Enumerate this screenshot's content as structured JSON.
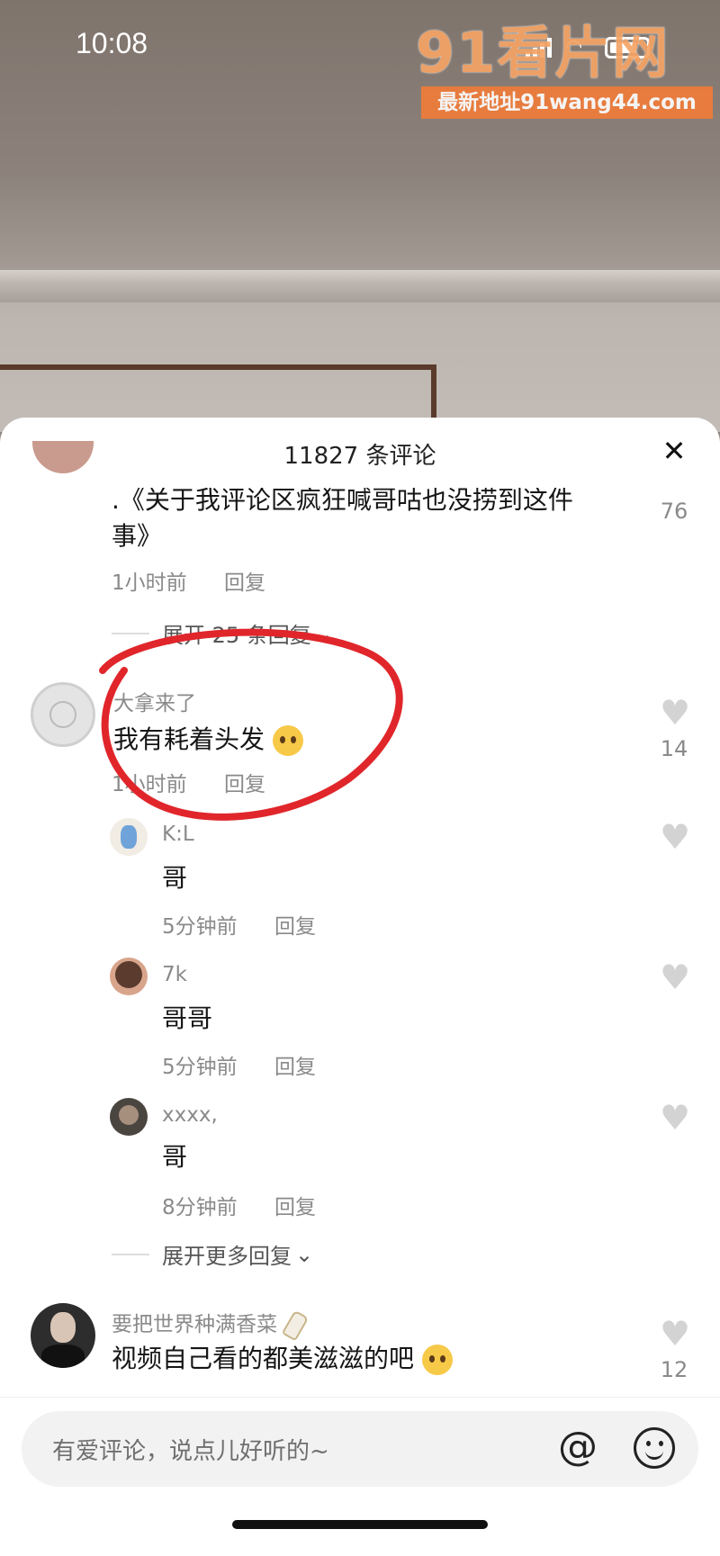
{
  "status": {
    "time": "10:08"
  },
  "watermark": {
    "logo": "91看片网",
    "url": "最新地址91wang44.com"
  },
  "sheet": {
    "title": "11827 条评论"
  },
  "comments": [
    {
      "text_line1": ".《关于我评论区疯狂喊哥咕也没捞到这件",
      "text_line2": "事》",
      "time": "1小时前",
      "reply": "回复",
      "likes": "76",
      "expand": "展开 25 条回复"
    },
    {
      "name": "大拿来了",
      "text": "我有耗着头发",
      "time": "1小时前",
      "reply": "回复",
      "likes": "14"
    },
    {
      "name": "要把世界种满香菜",
      "text": "视频自己看的都美滋滋的吧",
      "likes": "12"
    }
  ],
  "replies": [
    {
      "name": "K:L",
      "text": "哥",
      "time": "5分钟前",
      "reply": "回复"
    },
    {
      "name": "7k",
      "text": "哥哥",
      "time": "5分钟前",
      "reply": "回复"
    },
    {
      "name": "xxxx,",
      "text": "哥",
      "time": "8分钟前",
      "reply": "回复"
    }
  ],
  "more_replies": "展开更多回复",
  "input": {
    "placeholder": "有爱评论，说点儿好听的~"
  },
  "colors": {
    "annotation": "#e0262b",
    "sheet_bg": "#ffffff",
    "watermark": "#f07c3a"
  }
}
